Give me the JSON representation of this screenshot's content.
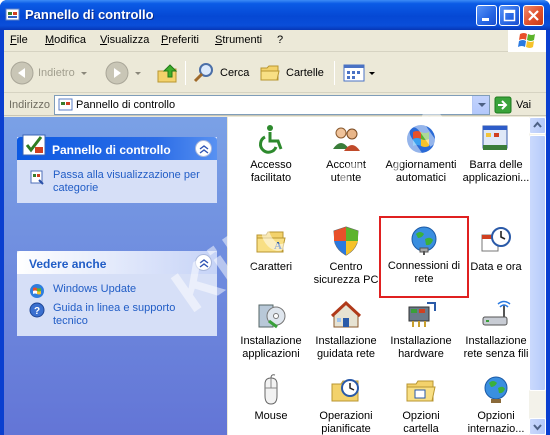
{
  "window": {
    "title": "Pannello di controllo"
  },
  "menubar": {
    "items": [
      "File",
      "Modifica",
      "Visualizza",
      "Preferiti",
      "Strumenti",
      "?"
    ]
  },
  "toolbar": {
    "back_label": "Indietro",
    "search_label": "Cerca",
    "folders_label": "Cartelle"
  },
  "addressbar": {
    "label": "Indirizzo",
    "value": "Pannello di controllo",
    "go_label": "Vai"
  },
  "sidepane": {
    "panel1": {
      "title": "Pannello di controllo",
      "tasks": [
        {
          "label": "Passa alla visualizzazione per categorie",
          "icon": "category-view-icon"
        }
      ]
    },
    "panel2": {
      "title": "Vedere anche",
      "tasks": [
        {
          "label": "Windows Update",
          "icon": "windows-update-icon"
        },
        {
          "label": "Guida in linea e supporto tecnico",
          "icon": "help-icon"
        }
      ]
    }
  },
  "items": [
    {
      "label1": "Accesso",
      "label2": "facilitato",
      "icon": "accessibility-icon"
    },
    {
      "label1": "Account",
      "label2": "utente",
      "icon": "user-accounts-icon"
    },
    {
      "label1": "Aggiornamenti",
      "label2": "automatici",
      "icon": "automatic-updates-icon"
    },
    {
      "label1": "Barra delle",
      "label2": "applicazioni...",
      "icon": "taskbar-icon"
    },
    {
      "label1": "Caratteri",
      "label2": "",
      "icon": "fonts-folder-icon"
    },
    {
      "label1": "Centro",
      "label2": "sicurezza PC",
      "icon": "security-center-shield-icon"
    },
    {
      "label1": "Connessioni di",
      "label2": "rete",
      "icon": "network-connections-globe-icon"
    },
    {
      "label1": "Data e ora",
      "label2": "",
      "icon": "date-time-clock-icon"
    },
    {
      "label1": "Installazione",
      "label2": "applicazioni",
      "icon": "add-remove-programs-icon"
    },
    {
      "label1": "Installazione",
      "label2": "guidata rete",
      "icon": "network-setup-wizard-icon"
    },
    {
      "label1": "Installazione",
      "label2": "hardware",
      "icon": "add-hardware-icon"
    },
    {
      "label1": "Installazione",
      "label2": "rete senza fili",
      "icon": "wireless-network-setup-icon"
    },
    {
      "label1": "Mouse",
      "label2": "",
      "icon": "mouse-icon"
    },
    {
      "label1": "Operazioni",
      "label2": "pianificate",
      "icon": "scheduled-tasks-icon"
    },
    {
      "label1": "Opzioni",
      "label2": "cartella",
      "icon": "folder-options-icon"
    },
    {
      "label1": "Opzioni",
      "label2": "internazio...",
      "icon": "regional-options-globe-icon"
    }
  ],
  "watermark": "Kikoo.com",
  "colors": {
    "highlight_border": "#e02020",
    "title_bar": "#0548d4",
    "link": "#215dc6"
  }
}
